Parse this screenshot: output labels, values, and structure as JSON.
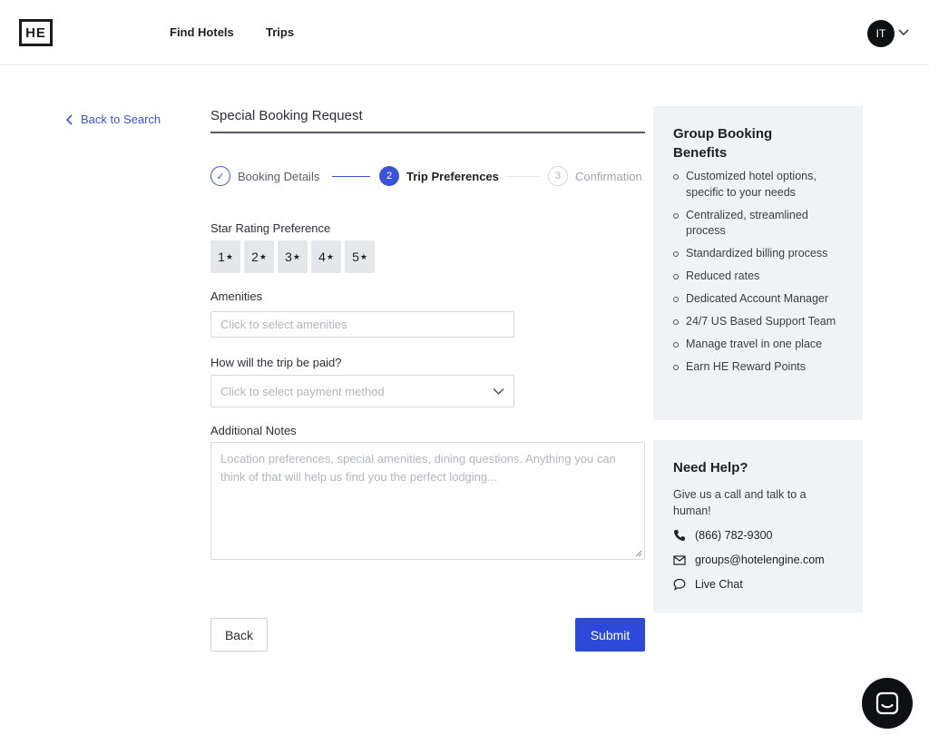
{
  "header": {
    "logo_text": "HE",
    "nav": [
      "Find Hotels",
      "Trips"
    ],
    "avatar_initials": "IT"
  },
  "back_link": "Back to Search",
  "page_title": "Special Booking Request",
  "steps": [
    {
      "number": "✓",
      "label": "Booking Details",
      "state": "complete"
    },
    {
      "number": "2",
      "label": "Trip Preferences",
      "state": "active"
    },
    {
      "number": "3",
      "label": "Confirmation",
      "state": "upcoming"
    }
  ],
  "star_rating": {
    "label": "Star Rating Preference",
    "options": [
      "1",
      "2",
      "3",
      "4",
      "5"
    ],
    "star_glyph": "★"
  },
  "amenities": {
    "label": "Amenities",
    "placeholder": "Click to select amenities"
  },
  "payment": {
    "label": "How will the trip be paid?",
    "placeholder": "Click to select payment method"
  },
  "notes": {
    "label": "Additional Notes",
    "placeholder": "Location preferences, special amenities, dining questions. Anything you can think of that will help us find you the perfect lodging..."
  },
  "buttons": {
    "back": "Back",
    "submit": "Submit"
  },
  "benefits_panel": {
    "title": "Group Booking Benefits",
    "items": [
      "Customized hotel options, specific to your needs",
      "Centralized, streamlined process",
      "Standardized billing process",
      "Reduced rates",
      "Dedicated Account Manager",
      "24/7 US Based Support Team",
      "Manage travel in one place",
      "Earn HE Reward Points"
    ]
  },
  "help_panel": {
    "title": "Need Help?",
    "text": "Give us a call and talk to a human!",
    "phone": "(866) 782-9300",
    "email": "groups@hotelengine.com",
    "chat": "Live Chat"
  },
  "colors": {
    "accent": "#2c49d8",
    "panel_bg": "#f1f2f6"
  },
  "icons": [
    "chevron-left-icon",
    "chevron-down-icon",
    "check-icon",
    "phone-icon",
    "mail-icon",
    "chat-bubble-icon",
    "chat-widget-icon"
  ]
}
